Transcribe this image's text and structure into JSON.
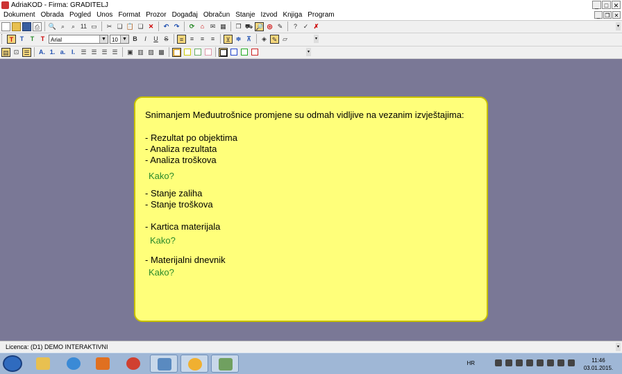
{
  "window": {
    "title": "AdriaKOD - Firma: GRADITELJ"
  },
  "menu": [
    "Dokument",
    "Obrada",
    "Pogled",
    "Unos",
    "Format",
    "Prozor",
    "Događaj",
    "Obračun",
    "Stanje",
    "Izvod",
    "Knjiga",
    "Program"
  ],
  "toolbar": {
    "font_name": "Arial",
    "font_size": "10",
    "zoom_label": "11"
  },
  "note": {
    "heading": "Snimanjem Međuutrošnice promjene su odmah vidljive na vezanim izvještajima:",
    "group1": [
      "- Rezultat po objektima",
      "- Analiza rezultata",
      "- Analiza troškova"
    ],
    "kako1": "Kako?",
    "group2": [
      "- Stanje zaliha",
      "- Stanje troškova"
    ],
    "group3": [
      "- Kartica materijala"
    ],
    "kako2": "Kako?",
    "group4": [
      "- Materijalni dnevnik"
    ],
    "kako3": "Kako?"
  },
  "status": {
    "licence": "Licenca:  (D1) DEMO INTERAKTIVNI"
  },
  "taskbar": {
    "language": "HR",
    "time": "11:46",
    "date": "03.01.2015."
  },
  "colors": {
    "note_bg": "#ffff7a",
    "note_border": "#c8c000",
    "kako_green": "#2a8a2a",
    "workspace": "#7a7896"
  }
}
